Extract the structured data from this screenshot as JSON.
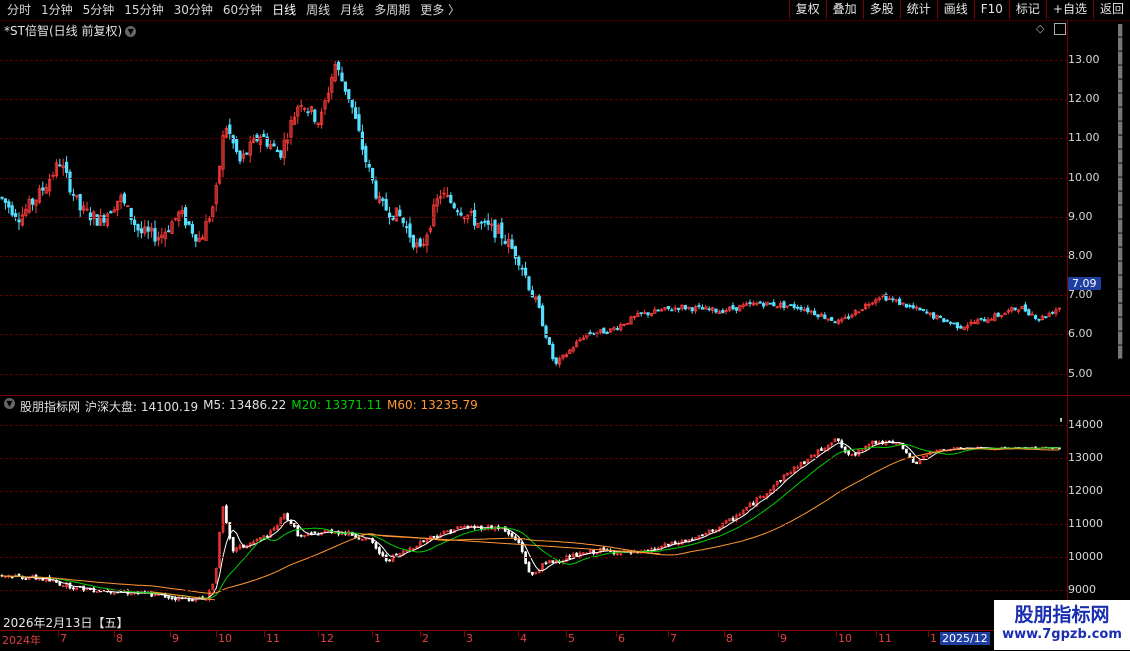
{
  "toolbar": {
    "periods": [
      "分时",
      "1分钟",
      "5分钟",
      "15分钟",
      "30分钟",
      "60分钟",
      "日线",
      "周线",
      "月线",
      "多周期",
      "更多 〉"
    ],
    "active_period": "日线",
    "right_buttons": [
      "复权",
      "叠加",
      "多股",
      "统计",
      "画线",
      "F10",
      "标记",
      "+自选",
      "返回"
    ]
  },
  "stock_panel": {
    "title": "*ST倍智(日线 前复权)",
    "current_price": "7.09",
    "y_labels": [
      "13.00",
      "12.00",
      "11.00",
      "10.00",
      "9.00",
      "8.00",
      "7.00",
      "6.00",
      "5.00"
    ]
  },
  "index_panel": {
    "indicator_name": "股朋指标网",
    "index_label": "沪深大盘: 14100.19",
    "m5_label": "M5: 13486.22",
    "m20_label": "M20: 13371.11",
    "m60_label": "M60: 13235.79",
    "y_labels": [
      "14000",
      "13000",
      "12000",
      "11000",
      "10000",
      "9000"
    ]
  },
  "date_axis": {
    "cursor_date": "2026年2月13日【五】",
    "year_label": "2024年",
    "months": [
      "7",
      "8",
      "9",
      "10",
      "11",
      "12",
      "1",
      "2",
      "3",
      "4",
      "5",
      "6",
      "7",
      "8",
      "9",
      "10",
      "11",
      "1"
    ],
    "end_label": "2025/12"
  },
  "watermark": {
    "title": "股朋指标网",
    "url": "www.7gpzb.com"
  },
  "colors": {
    "up": "#ff3b3b",
    "down": "#55e0ff",
    "m5": "#ffffff",
    "m20": "#00d000",
    "m60": "#ff9933"
  }
}
